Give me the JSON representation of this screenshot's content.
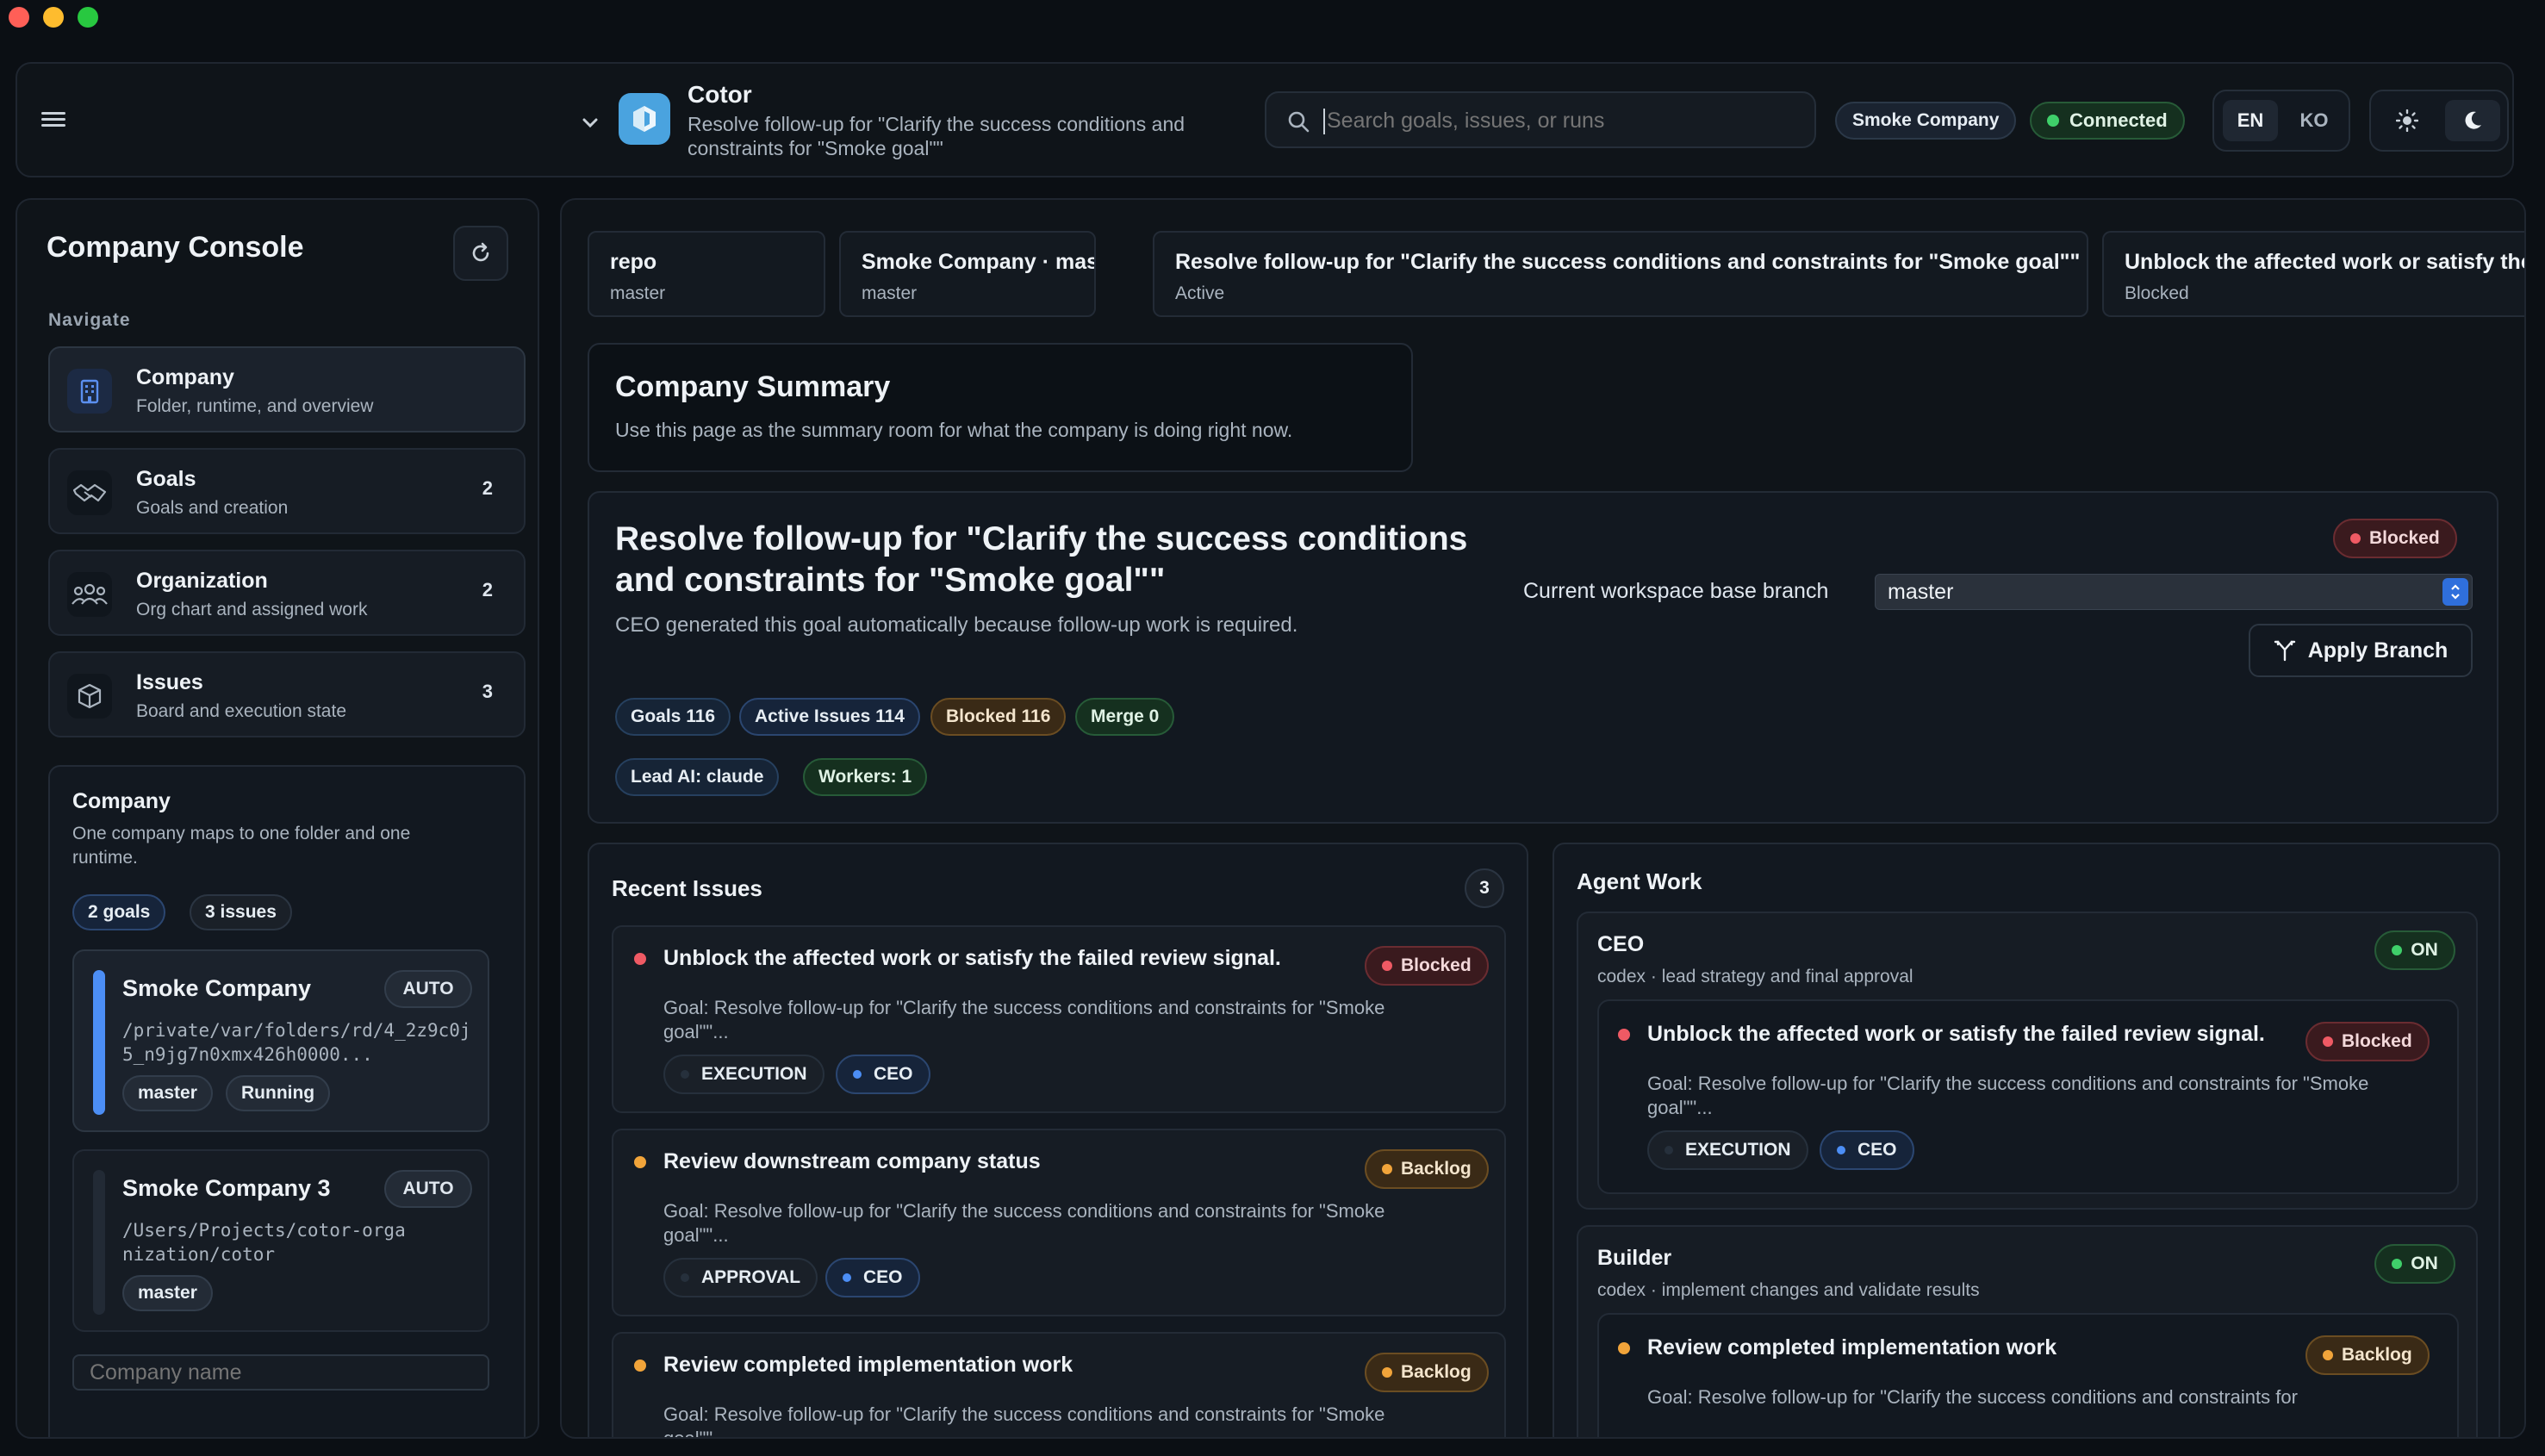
{
  "window": {
    "traffic_lights": {
      "close": "#ff5f57",
      "minimize": "#febc2e",
      "zoom": "#28c840"
    }
  },
  "header": {
    "app_name": "Cotor",
    "subtitle": "Resolve follow-up for \"Clarify the success conditions and constraints for \"Smoke goal\"\"",
    "search_placeholder": "Search goals, issues, or runs",
    "company_badge": "Smoke Company",
    "connection_status": "Connected",
    "lang_en": "EN",
    "lang_ko": "KO",
    "accent_color": "#4aa3df"
  },
  "sidebar": {
    "title": "Company Console",
    "nav_heading": "Navigate",
    "items": [
      {
        "label": "Company",
        "sub": "Folder, runtime, and overview",
        "count": "",
        "icon": "building-icon"
      },
      {
        "label": "Goals",
        "sub": "Goals and creation",
        "count": "2",
        "icon": "handshake-icon"
      },
      {
        "label": "Organization",
        "sub": "Org chart and assigned work",
        "count": "2",
        "icon": "people-icon"
      },
      {
        "label": "Issues",
        "sub": "Board and execution state",
        "count": "3",
        "icon": "cube-icon"
      }
    ],
    "company_card": {
      "title": "Company",
      "desc": "One company maps to one folder and one runtime.",
      "chip_goals": "2 goals",
      "chip_issues": "3 issues",
      "companies": [
        {
          "name": "Smoke Company",
          "mode": "AUTO",
          "path": "/private/var/folders/rd/4_2z9c0j5_n9jg7n0xmx426h0000...",
          "branch": "master",
          "state": "Running"
        },
        {
          "name": "Smoke Company 3",
          "mode": "AUTO",
          "path": "/Users/Projects/cotor-organization/cotor",
          "branch": "master",
          "state": ""
        }
      ],
      "name_placeholder": "Company name"
    }
  },
  "breadcrumbs": [
    {
      "title": "repo",
      "sub": "master"
    },
    {
      "title": "Smoke Company · master",
      "sub": "master"
    },
    {
      "title": "Resolve follow-up for \"Clarify the success conditions and constraints for \"Smoke goal\"\"",
      "sub": "Active"
    },
    {
      "title": "Unblock the affected work or satisfy the failed review signal.",
      "sub": "Blocked"
    }
  ],
  "summary": {
    "title": "Company Summary",
    "desc": "Use this page as the summary room for what the company is doing right now."
  },
  "goal": {
    "title": "Resolve follow-up for \"Clarify the success conditions and constraints for \"Smoke goal\"\"",
    "desc": "CEO generated this goal automatically because follow-up work is required.",
    "status": "Blocked",
    "branch_label": "Current workspace base branch",
    "branch_value": "master",
    "apply_label": "Apply Branch",
    "chips": [
      "Goals 116",
      "Active Issues 114",
      "Blocked 116",
      "Merge 0"
    ],
    "meta": [
      "Lead AI: claude",
      "Workers: 1"
    ]
  },
  "recent_issues": {
    "title": "Recent Issues",
    "count": "3",
    "items": [
      {
        "title": "Unblock the affected work or satisfy the failed review signal.",
        "goal": "Goal: Resolve follow-up for \"Clarify the success conditions and constraints for \"Smoke goal\"\"...",
        "status": "Blocked",
        "kind": "EXECUTION",
        "owner": "CEO"
      },
      {
        "title": "Review downstream company status",
        "goal": "Goal: Resolve follow-up for \"Clarify the success conditions and constraints for \"Smoke goal\"\"...",
        "status": "Backlog",
        "kind": "APPROVAL",
        "owner": "CEO"
      },
      {
        "title": "Review completed implementation work",
        "goal": "Goal: Resolve follow-up for \"Clarify the success conditions and constraints for \"Smoke goal\"\"...",
        "status": "Backlog",
        "kind": "",
        "owner": ""
      }
    ]
  },
  "agent_work": {
    "title": "Agent Work",
    "agents": [
      {
        "name": "CEO",
        "desc": "codex · lead strategy and final approval",
        "state": "ON",
        "task": {
          "title": "Unblock the affected work or satisfy the failed review signal.",
          "goal": "Goal: Resolve follow-up for \"Clarify the success conditions and constraints for \"Smoke goal\"\"...",
          "status": "Blocked",
          "kind": "EXECUTION",
          "owner": "CEO"
        }
      },
      {
        "name": "Builder",
        "desc": "codex · implement changes and validate results",
        "state": "ON",
        "task": {
          "title": "Review completed implementation work",
          "goal": "Goal: Resolve follow-up for \"Clarify the success conditions and constraints for",
          "status": "Backlog",
          "kind": "",
          "owner": ""
        }
      }
    ]
  }
}
